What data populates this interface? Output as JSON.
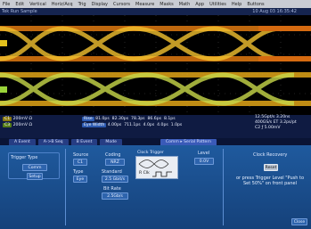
{
  "menu": [
    "File",
    "Edit",
    "Vertical",
    "Horiz/Acq",
    "Trig",
    "Display",
    "Cursors",
    "Measure",
    "Masks",
    "Math",
    "App",
    "Utilities",
    "Help",
    "Buttons"
  ],
  "toolbar": {
    "left": "Tek  Run  Sample",
    "date": "10 Aug 03 16:35:42"
  },
  "channels": [
    {
      "label": "C1",
      "scale": "200mV",
      "term": "Ω"
    },
    {
      "label": "C3",
      "scale": "200mV",
      "term": "Ω"
    }
  ],
  "measurements": [
    {
      "name": "Rise",
      "val1": "81.0ps",
      "val2": "82.30ps",
      "val3": "78.3ps",
      "val4": "86.6ps",
      "val5": "8.1ps"
    },
    {
      "name": "Eye Width",
      "val1": "4.00ps",
      "val2": "711.1ps",
      "val3": "4.0ps",
      "val4": "4.0ps",
      "val5": "1.0ps"
    }
  ],
  "acq": {
    "line1": "12.5Gpt/s  3.20ns",
    "line2": "400GS/s ET  3.2ps/pt",
    "line3": "C2  ƒ  5.00mV"
  },
  "tabs": [
    "A Event",
    "A->B Seq",
    "B Event",
    "Mode",
    "Comm  ▸  Serial Pattern"
  ],
  "trigger": {
    "type_label": "Trigger Type",
    "type_value": "Comm",
    "extra": "Setup"
  },
  "source": {
    "label": "Source",
    "value": "C1"
  },
  "type_field": {
    "label": "Type",
    "value": "Eye"
  },
  "coding": {
    "label": "Coding",
    "value": "NRZ"
  },
  "standard": {
    "label": "Standard",
    "value": "2.5 Gbit/s"
  },
  "bitrate": {
    "label": "Bit Rate",
    "value": "2.5Gb/s"
  },
  "clock_trigger": {
    "label": "Clock Trigger",
    "rclk": "R Clk"
  },
  "level": {
    "label": "Level",
    "value": "0.0V"
  },
  "clock_recovery": {
    "label": "Clock Recovery",
    "button": "Reset",
    "hint": "or press Trigger Level \"Push to Set 50%\" on front panel"
  },
  "close_label": "Close"
}
